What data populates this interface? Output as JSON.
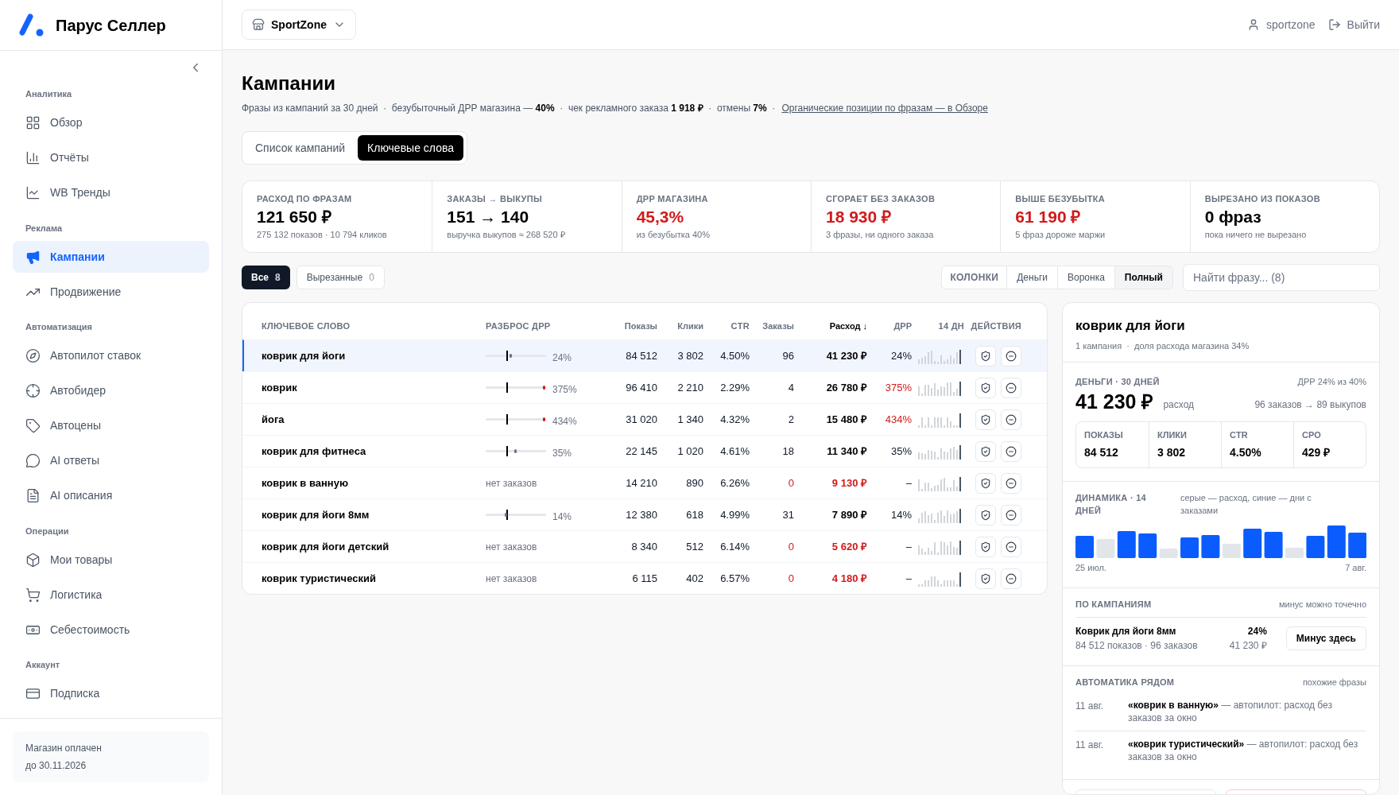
{
  "brand": {
    "name": "Парус Селлер"
  },
  "sidebar": {
    "sections": [
      {
        "title": "Аналитика",
        "items": [
          {
            "label": "Обзор",
            "selected": false
          },
          {
            "label": "Отчёты",
            "selected": false
          },
          {
            "label": "WB Тренды",
            "selected": false
          }
        ]
      },
      {
        "title": "Реклама",
        "items": [
          {
            "label": "Кампании",
            "selected": true
          },
          {
            "label": "Продвижение",
            "selected": false
          }
        ]
      },
      {
        "title": "Автоматизация",
        "items": [
          {
            "label": "Автопилот ставок",
            "selected": false
          },
          {
            "label": "Автобидер",
            "selected": false
          },
          {
            "label": "Автоцены",
            "selected": false
          },
          {
            "label": "AI ответы",
            "selected": false
          },
          {
            "label": "AI описания",
            "selected": false
          }
        ]
      },
      {
        "title": "Операции",
        "items": [
          {
            "label": "Мои товары",
            "selected": false
          },
          {
            "label": "Логистика",
            "selected": false
          },
          {
            "label": "Себестоимость",
            "selected": false
          }
        ]
      },
      {
        "title": "Аккаунт",
        "items": [
          {
            "label": "Подписка",
            "selected": false
          }
        ]
      }
    ],
    "footer": {
      "line1": "Магазин оплачен",
      "line2": "до 30.11.2026"
    }
  },
  "header": {
    "store": "SportZone",
    "user": "sportzone",
    "logout": "Выйти"
  },
  "page": {
    "title": "Кампании",
    "subtitle": "Фразы из кампаний за 30 дней  ·  безубыточный ДРР магазина — **40%**  ·  чек рекламного заказа **1 918 ₽**  ·  отмены **7%**  ·",
    "subtitle_link": "Органические позиции по фразам — в Обзоре"
  },
  "view_tabs": [
    {
      "label": "Список кампаний",
      "selected": false
    },
    {
      "label": "Ключевые слова",
      "selected": true
    }
  ],
  "kpis": [
    {
      "label": "РАСХОД ПО ФРАЗАМ",
      "value": "121 650 ₽",
      "note": "275 132 показов · 10 794 кликов",
      "alert": false
    },
    {
      "label": "ЗАКАЗЫ → ВЫКУПЫ",
      "value": "151 → 140",
      "note": "выручка выкупов ≈ 268 520 ₽",
      "alert": false
    },
    {
      "label": "ДРР МАГАЗИНА",
      "value": "45,3%",
      "note": "из безубытка 40%",
      "alert": true
    },
    {
      "label": "СГОРАЕТ БЕЗ ЗАКАЗОВ",
      "value": "18 930 ₽",
      "note": "3 фразы, ни одного заказа",
      "alert": true
    },
    {
      "label": "ВЫШЕ БЕЗУБЫТКА",
      "value": "61 190 ₽",
      "note": "5 фраз дороже маржи",
      "alert": true
    },
    {
      "label": "ВЫРЕЗАНО ИЗ ПОКАЗОВ",
      "value": "0 фраз",
      "note": "пока ничего не вырезано",
      "alert": false
    }
  ],
  "filters": [
    {
      "label": "Все",
      "count": "8",
      "selected": true
    },
    {
      "label": "Вырезанные",
      "count": "0",
      "selected": false
    }
  ],
  "columns_toggle": {
    "label": "КОЛОНКИ",
    "options": [
      {
        "label": "Деньги",
        "selected": false
      },
      {
        "label": "Воронка",
        "selected": false
      },
      {
        "label": "Полный",
        "selected": true
      }
    ]
  },
  "search": {
    "placeholder": "Найти фразу... (8)"
  },
  "table": {
    "columns": [
      "КЛЮЧЕВОЕ СЛОВО",
      "РАЗБРОС ДРР",
      "Показы",
      "Клики",
      "CTR",
      "Заказы",
      "Расход ↓",
      "ДРР",
      "14 ДН",
      "ДЕЙСТВИЯ"
    ],
    "rows": [
      {
        "keyword": "коврик для йоги",
        "kind": "ok",
        "level": 0.4,
        "spread": "24%",
        "shows": "84 512",
        "clicks": "3 802",
        "ctr": "4.50%",
        "orders": "96",
        "spend": "41 230 ₽",
        "drr": "24%",
        "selected": true
      },
      {
        "keyword": "коврик",
        "kind": "over",
        "level": 0.95,
        "spread": "375%",
        "shows": "96 410",
        "clicks": "2 210",
        "ctr": "2.29%",
        "orders": "4",
        "spend": "26 780 ₽",
        "drr": "375%",
        "selected": false
      },
      {
        "keyword": "йога",
        "kind": "over",
        "level": 0.95,
        "spread": "434%",
        "shows": "31 020",
        "clicks": "1 340",
        "ctr": "4.32%",
        "orders": "2",
        "spend": "15 480 ₽",
        "drr": "434%",
        "selected": false
      },
      {
        "keyword": "коврик для фитнеса",
        "kind": "ok",
        "level": 0.48,
        "spread": "35%",
        "shows": "22 145",
        "clicks": "1 020",
        "ctr": "4.61%",
        "orders": "18",
        "spend": "11 340 ₽",
        "drr": "35%",
        "selected": false
      },
      {
        "keyword": "коврик в ванную",
        "kind": "no_orders",
        "spread": "нет заказов",
        "shows": "14 210",
        "clicks": "890",
        "ctr": "6.26%",
        "orders": "0",
        "spend": "9 130 ₽",
        "drr": "–",
        "selected": false
      },
      {
        "keyword": "коврик для йоги 8мм",
        "kind": "ok",
        "level": 0.32,
        "spread": "14%",
        "shows": "12 380",
        "clicks": "618",
        "ctr": "4.99%",
        "orders": "31",
        "spend": "7 890 ₽",
        "drr": "14%",
        "selected": false
      },
      {
        "keyword": "коврик для йоги детский",
        "kind": "no_orders",
        "spread": "нет заказов",
        "shows": "8 340",
        "clicks": "512",
        "ctr": "6.14%",
        "orders": "0",
        "spend": "5 620 ₽",
        "drr": "–",
        "selected": false
      },
      {
        "keyword": "коврик туристический",
        "kind": "no_orders",
        "spread": "нет заказов",
        "shows": "6 115",
        "clicks": "402",
        "ctr": "6.57%",
        "orders": "0",
        "spend": "4 180 ₽",
        "drr": "–",
        "selected": false
      }
    ]
  },
  "detail": {
    "title": "коврик для йоги",
    "meta": "1 кампания  ·  доля расхода магазина 34%",
    "money_title": "ДЕНЬГИ · 30 ДНЕЙ",
    "money_drr": "ДРР 24% из 40%",
    "money_value": "41 230 ₽",
    "money_caption": "расход",
    "money_funnel": "96 заказов → 89 выкупов",
    "stats": [
      {
        "label": "ПОКАЗЫ",
        "value": "84 512"
      },
      {
        "label": "КЛИКИ",
        "value": "3 802"
      },
      {
        "label": "CTR",
        "value": "4.50%"
      },
      {
        "label": "CPO",
        "value": "429 ₽"
      }
    ],
    "dynamics_title": "ДИНАМИКА · 14 ДНЕЙ",
    "dynamics_note": "серые — расход, синие — дни с заказами",
    "days": [
      {
        "orders": true
      },
      {
        "orders": false
      },
      {
        "orders": true
      },
      {
        "orders": true
      },
      {
        "orders": false
      },
      {
        "orders": true
      },
      {
        "orders": true
      },
      {
        "orders": false
      },
      {
        "orders": true
      },
      {
        "orders": true
      },
      {
        "orders": false
      },
      {
        "orders": true
      },
      {
        "orders": true
      },
      {
        "orders": true
      }
    ],
    "date_start": "25 июл.",
    "date_end": "7 авг.",
    "campaigns_title": "ПО КАМПАНИЯМ",
    "campaigns_note": "минус можно точечно",
    "campaigns": [
      {
        "name": "Коврик для йоги 8мм",
        "meta": "84 512 показов · 96 заказов",
        "drr": "24%",
        "spend": "41 230 ₽",
        "button": "Минус здесь"
      }
    ],
    "auto_title": "АВТОМАТИКА РЯДОМ",
    "auto_note": "похожие фразы",
    "events": [
      {
        "date": "11 авг.",
        "text": "**«коврик в ванную»** — автопилот: расход без заказов за окно"
      },
      {
        "date": "11 авг.",
        "text": "**«коврик туристический»** — автопилот: расход без заказов за окно"
      }
    ]
  }
}
